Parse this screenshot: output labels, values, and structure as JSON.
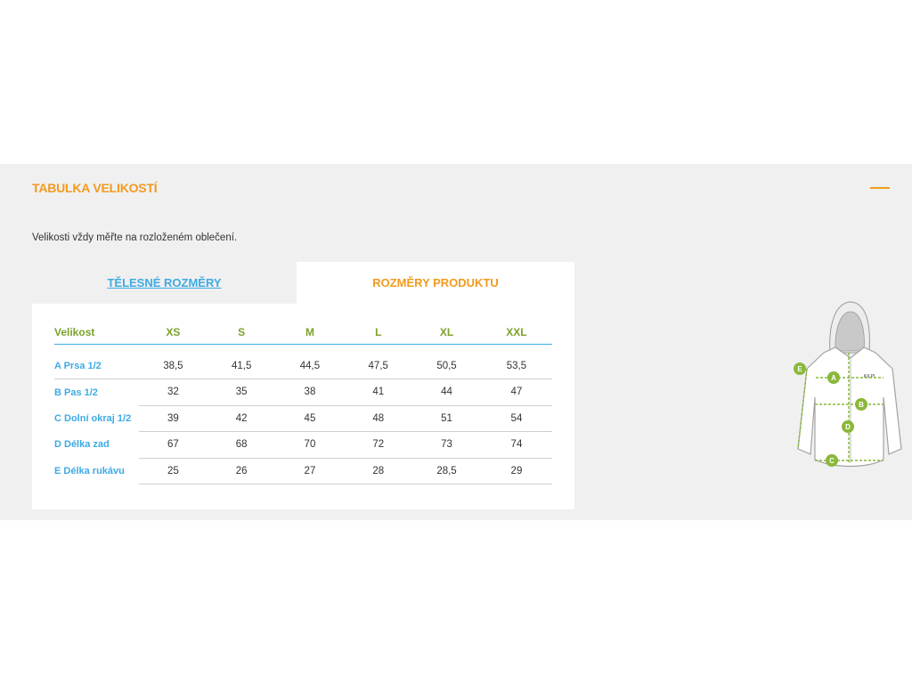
{
  "section": {
    "title": "TABULKA VELIKOSTÍ",
    "intro": "Velikosti vždy měřte na rozloženém oblečení."
  },
  "tabs": [
    {
      "label": "TĚLESNÉ ROZMĚRY",
      "active": false
    },
    {
      "label": "ROZMĚRY PRODUKTU",
      "active": true
    }
  ],
  "table": {
    "headers": [
      "Velikost",
      "XS",
      "S",
      "M",
      "L",
      "XL",
      "XXL"
    ],
    "rows": [
      {
        "label": "A Prsa 1/2",
        "values": [
          "38,5",
          "41,5",
          "44,5",
          "47,5",
          "50,5",
          "53,5"
        ]
      },
      {
        "label": "B Pas 1/2",
        "values": [
          "32",
          "35",
          "38",
          "41",
          "44",
          "47"
        ]
      },
      {
        "label": "C Dolní okraj 1/2",
        "values": [
          "39",
          "42",
          "45",
          "48",
          "51",
          "54"
        ]
      },
      {
        "label": "D Délka zad",
        "values": [
          "67",
          "68",
          "70",
          "72",
          "73",
          "74"
        ]
      },
      {
        "label": "E Délka rukávu",
        "values": [
          "25",
          "26",
          "27",
          "28",
          "28,5",
          "29"
        ]
      }
    ]
  },
  "diagram": {
    "markers": [
      "A",
      "B",
      "C",
      "D",
      "E"
    ],
    "logo_text": "KILPI"
  },
  "colors": {
    "accent_orange": "#f29a1f",
    "accent_blue": "#3eaae4",
    "accent_green": "#7aa22b",
    "panel_bg": "#f0f0f0"
  }
}
